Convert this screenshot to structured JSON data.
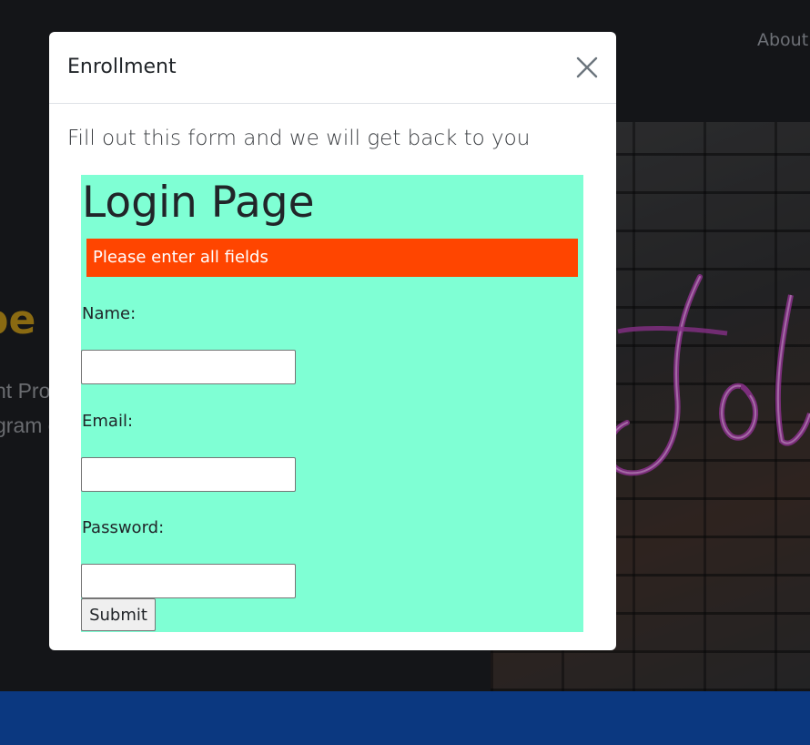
{
  "background": {
    "nav": {
      "about_label": "About"
    },
    "hero": {
      "heading_fragment": "pe",
      "line1_fragment": "nt Pro",
      "line2_fragment": "gram c"
    }
  },
  "modal": {
    "title": "Enrollment",
    "close_icon": "close-icon",
    "lead": "Fill out this form and we will get back to you",
    "login": {
      "heading": "Login Page",
      "alert_text": "Please enter all fields",
      "name_label": "Name:",
      "name_value": "",
      "email_label": "Email:",
      "email_value": "",
      "password_label": "Password:",
      "password_value": "",
      "submit_label": "Submit"
    }
  },
  "colors": {
    "modal_bg": "#ffffff",
    "login_panel_bg": "#7fffd4",
    "alert_bg": "#ff4500",
    "page_bg": "#141518",
    "footer_bg": "#0b3880",
    "hero_heading": "#8a6a12"
  }
}
